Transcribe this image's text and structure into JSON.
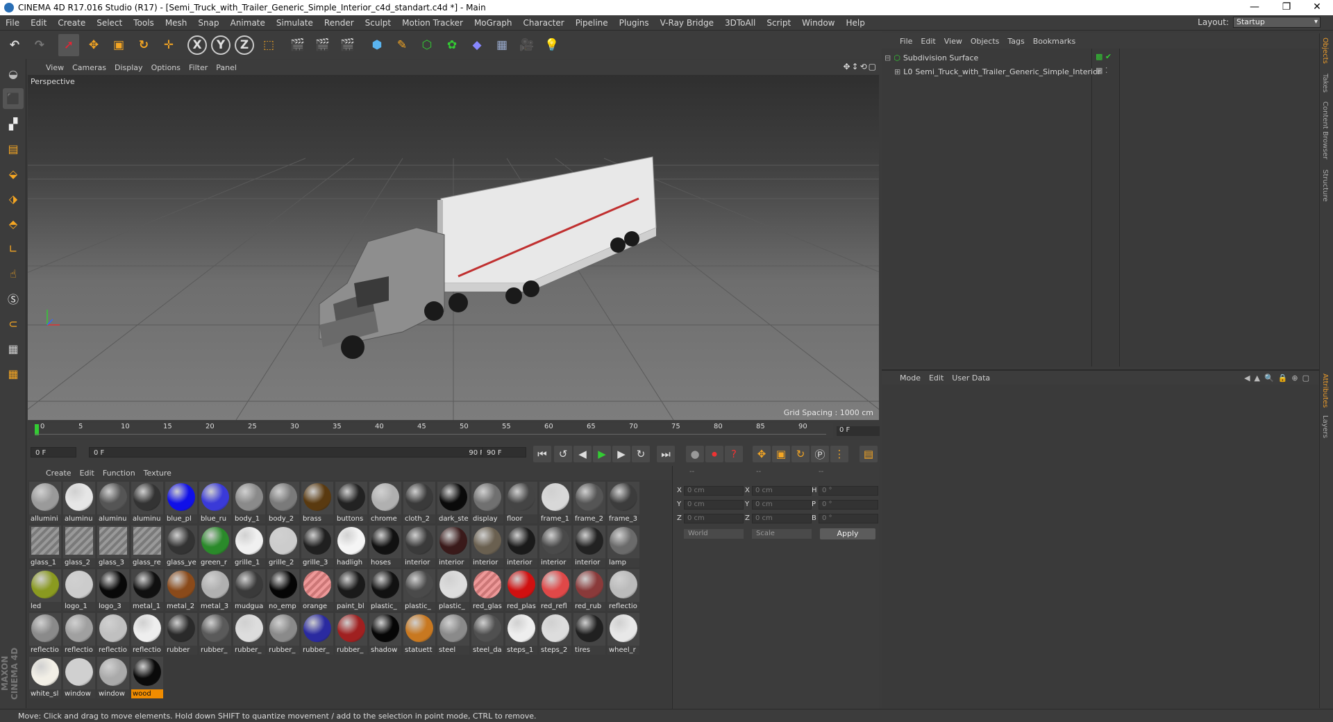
{
  "window": {
    "title": "CINEMA 4D R17.016 Studio (R17) - [Semi_Truck_with_Trailer_Generic_Simple_Interior_c4d_standart.c4d *] - Main",
    "controls": [
      "—",
      "❐",
      "✕"
    ]
  },
  "menubar": {
    "items": [
      "File",
      "Edit",
      "Create",
      "Select",
      "Tools",
      "Mesh",
      "Snap",
      "Animate",
      "Simulate",
      "Render",
      "Sculpt",
      "Motion Tracker",
      "MoGraph",
      "Character",
      "Pipeline",
      "Plugins",
      "V-Ray Bridge",
      "3DToAll",
      "Script",
      "Window",
      "Help"
    ],
    "layout_label": "Layout:",
    "layout_value": "Startup"
  },
  "toolbar": {
    "axis": [
      "X",
      "Y",
      "Z"
    ]
  },
  "viewport": {
    "menu": [
      "View",
      "Cameras",
      "Display",
      "Options",
      "Filter",
      "Panel"
    ],
    "label": "Perspective",
    "grid_spacing": "Grid Spacing : 1000 cm"
  },
  "timeline": {
    "ticks": [
      "0",
      "5",
      "10",
      "15",
      "20",
      "25",
      "30",
      "35",
      "40",
      "45",
      "50",
      "55",
      "60",
      "65",
      "70",
      "75",
      "80",
      "85",
      "90"
    ],
    "current_right": "0 F",
    "start": "0 F",
    "range_start": "0 F",
    "range_end": "90 F",
    "end": "90 F"
  },
  "materials": {
    "menu": [
      "Create",
      "Edit",
      "Function",
      "Texture"
    ],
    "items": [
      {
        "n": "allumini",
        "c": "#9a9a9a"
      },
      {
        "n": "aluminu",
        "c": "#e6e6e6"
      },
      {
        "n": "aluminu",
        "c": "#555555"
      },
      {
        "n": "aluminu",
        "c": "#333333"
      },
      {
        "n": "blue_pl",
        "c": "#1010e8"
      },
      {
        "n": "blue_ru",
        "c": "#3a3ad8"
      },
      {
        "n": "body_1",
        "c": "#8a8a8a"
      },
      {
        "n": "body_2",
        "c": "#7a7a7a"
      },
      {
        "n": "brass",
        "c": "#5a3a10"
      },
      {
        "n": "buttons",
        "c": "#222222"
      },
      {
        "n": "chrome",
        "c": "#b0b0b0"
      },
      {
        "n": "cloth_2",
        "c": "#3a3a3a"
      },
      {
        "n": "dark_ste",
        "c": "#0a0a0a"
      },
      {
        "n": "display",
        "c": "#707070"
      },
      {
        "n": "floor",
        "c": "#444444"
      },
      {
        "n": "frame_1",
        "c": "#d8d8d8"
      },
      {
        "n": "frame_2",
        "c": "#555555"
      },
      {
        "n": "frame_3",
        "c": "#3c3c3c"
      },
      {
        "n": "glass_1",
        "c": "stripe"
      },
      {
        "n": "glass_2",
        "c": "stripe"
      },
      {
        "n": "glass_3",
        "c": "stripe"
      },
      {
        "n": "glass_re",
        "c": "stripe"
      },
      {
        "n": "glass_ye",
        "c": "#333333"
      },
      {
        "n": "green_r",
        "c": "#2a8a2a"
      },
      {
        "n": "grille_1",
        "c": "#f0f0f0"
      },
      {
        "n": "grille_2",
        "c": "#cccccc"
      },
      {
        "n": "grille_3",
        "c": "#202020"
      },
      {
        "n": "hadligh",
        "c": "#f5f5f5"
      },
      {
        "n": "hoses",
        "c": "#111111"
      },
      {
        "n": "interior",
        "c": "#3a3a3a"
      },
      {
        "n": "interior",
        "c": "#3a1a1a"
      },
      {
        "n": "interior",
        "c": "#6a6050"
      },
      {
        "n": "interior",
        "c": "#1a1a1a"
      },
      {
        "n": "interior",
        "c": "#4a4a4a"
      },
      {
        "n": "interior",
        "c": "#222222"
      },
      {
        "n": "lamp",
        "c": "#6a6a6a"
      },
      {
        "n": "led",
        "c": "#8a9a20"
      },
      {
        "n": "logo_1",
        "c": "#cccccc"
      },
      {
        "n": "logo_3",
        "c": "#080808"
      },
      {
        "n": "metal_1",
        "c": "#101010"
      },
      {
        "n": "metal_2",
        "c": "#8a4a1a"
      },
      {
        "n": "metal_3",
        "c": "#b0b0b0"
      },
      {
        "n": "mudgua",
        "c": "#3a3a3a"
      },
      {
        "n": "no_emp",
        "c": "#050505"
      },
      {
        "n": "orange",
        "c": "stripe_red"
      },
      {
        "n": "paint_bl",
        "c": "#1a1a1a"
      },
      {
        "n": "plastic_",
        "c": "#111111"
      },
      {
        "n": "plastic_",
        "c": "#4a4a4a"
      },
      {
        "n": "plastic_",
        "c": "#dddddd"
      },
      {
        "n": "red_glas",
        "c": "stripe_red"
      },
      {
        "n": "red_plas",
        "c": "#d01010"
      },
      {
        "n": "red_refl",
        "c": "#e04848"
      },
      {
        "n": "red_rub",
        "c": "#8a3a3a"
      },
      {
        "n": "reflectio",
        "c": "#bbbbbb"
      },
      {
        "n": "reflectio",
        "c": "#8a8a8a"
      },
      {
        "n": "reflectio",
        "c": "#a0a0a0"
      },
      {
        "n": "reflectio",
        "c": "#c0c0c0"
      },
      {
        "n": "reflectio",
        "c": "#eeeeee"
      },
      {
        "n": "rubber",
        "c": "#2a2a2a"
      },
      {
        "n": "rubber_",
        "c": "#5a5a5a"
      },
      {
        "n": "rubber_",
        "c": "#dddddd"
      },
      {
        "n": "rubber_",
        "c": "#8a8a8a"
      },
      {
        "n": "rubber_",
        "c": "#2a2aa0"
      },
      {
        "n": "rubber_",
        "c": "#a02020"
      },
      {
        "n": "shadow",
        "c": "#060606"
      },
      {
        "n": "statuett",
        "c": "#c87820"
      },
      {
        "n": "steel",
        "c": "#8a8a8a"
      },
      {
        "n": "steel_da",
        "c": "#505050"
      },
      {
        "n": "steps_1",
        "c": "#eeeeee"
      },
      {
        "n": "steps_2",
        "c": "#dddddd"
      },
      {
        "n": "tires",
        "c": "#202020"
      },
      {
        "n": "wheel_r",
        "c": "#e8e8e8"
      },
      {
        "n": "white_sl",
        "c": "#f2efe6"
      },
      {
        "n": "window",
        "c": "#d0d0d0"
      },
      {
        "n": "window",
        "c": "#aaaaaa"
      },
      {
        "n": "wood",
        "c": "#0a0a0a"
      }
    ],
    "selected_index": 75
  },
  "coords": {
    "headers": [
      "--",
      "--",
      "--"
    ],
    "rows": [
      {
        "a": "X",
        "av": "0 cm",
        "b": "X",
        "bv": "0 cm",
        "c": "H",
        "cv": "0 °"
      },
      {
        "a": "Y",
        "av": "0 cm",
        "b": "Y",
        "bv": "0 cm",
        "c": "P",
        "cv": "0 °"
      },
      {
        "a": "Z",
        "av": "0 cm",
        "b": "Z",
        "bv": "0 cm",
        "c": "B",
        "cv": "0 °"
      }
    ],
    "world": "World",
    "scale": "Scale",
    "apply": "Apply"
  },
  "objects": {
    "menu": [
      "File",
      "Edit",
      "View",
      "Objects",
      "Tags",
      "Bookmarks"
    ],
    "items": [
      {
        "name": "Subdivision Surface"
      },
      {
        "name": "Semi_Truck_with_Trailer_Generic_Simple_Interior"
      }
    ]
  },
  "attributes": {
    "menu": [
      "Mode",
      "Edit",
      "User Data"
    ]
  },
  "right_tabs": [
    "Objects",
    "Takes",
    "Content Browser",
    "Structure",
    "Attributes",
    "Layers"
  ],
  "status": "Move: Click and drag to move elements. Hold down SHIFT to quantize movement / add to the selection in point mode, CTRL to remove.",
  "brand": "MAXON CINEMA 4D"
}
